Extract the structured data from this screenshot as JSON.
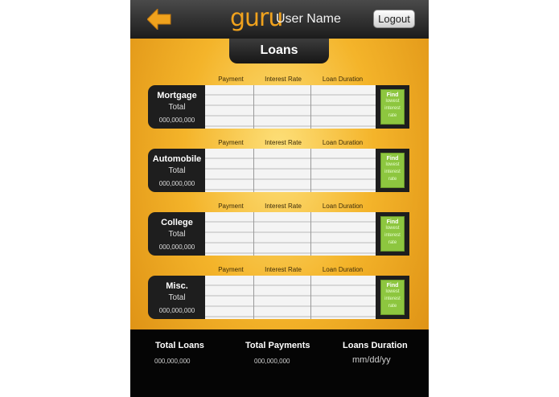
{
  "header": {
    "brand": "guru",
    "username": "User Name",
    "logout_label": "Logout",
    "back_icon": "back-arrow-icon",
    "accent": "#f0a21d"
  },
  "page_title": "Loans",
  "columns": {
    "payment": "Payment",
    "interest": "Interest Rate",
    "duration": "Loan Duration"
  },
  "loans": [
    {
      "name": "Mortgage",
      "total_label": "Total",
      "amount": "000,000,000",
      "find_title": "Find",
      "find_lines": [
        "lowest",
        "interest",
        "rate"
      ]
    },
    {
      "name": "Automobile",
      "total_label": "Total",
      "amount": "000,000,000",
      "find_title": "Find",
      "find_lines": [
        "lowest",
        "interest",
        "rate"
      ]
    },
    {
      "name": "College",
      "total_label": "Total",
      "amount": "000,000,000",
      "find_title": "Find",
      "find_lines": [
        "lowest",
        "interest",
        "rate"
      ]
    },
    {
      "name": "Misc.",
      "total_label": "Total",
      "amount": "000,000,000",
      "find_title": "Find",
      "find_lines": [
        "lowest",
        "interest",
        "rate"
      ]
    }
  ],
  "footer": {
    "total_loans_label": "Total Loans",
    "total_loans_value": "000,000,000",
    "total_payments_label": "Total Payments",
    "total_payments_value": "000,000,000",
    "duration_label": "Loans Duration",
    "duration_value": "mm/dd/yy"
  },
  "colors": {
    "find_button": "#8dc63f",
    "dark_panel": "#1e1e1e",
    "background": "#f4b42a"
  }
}
